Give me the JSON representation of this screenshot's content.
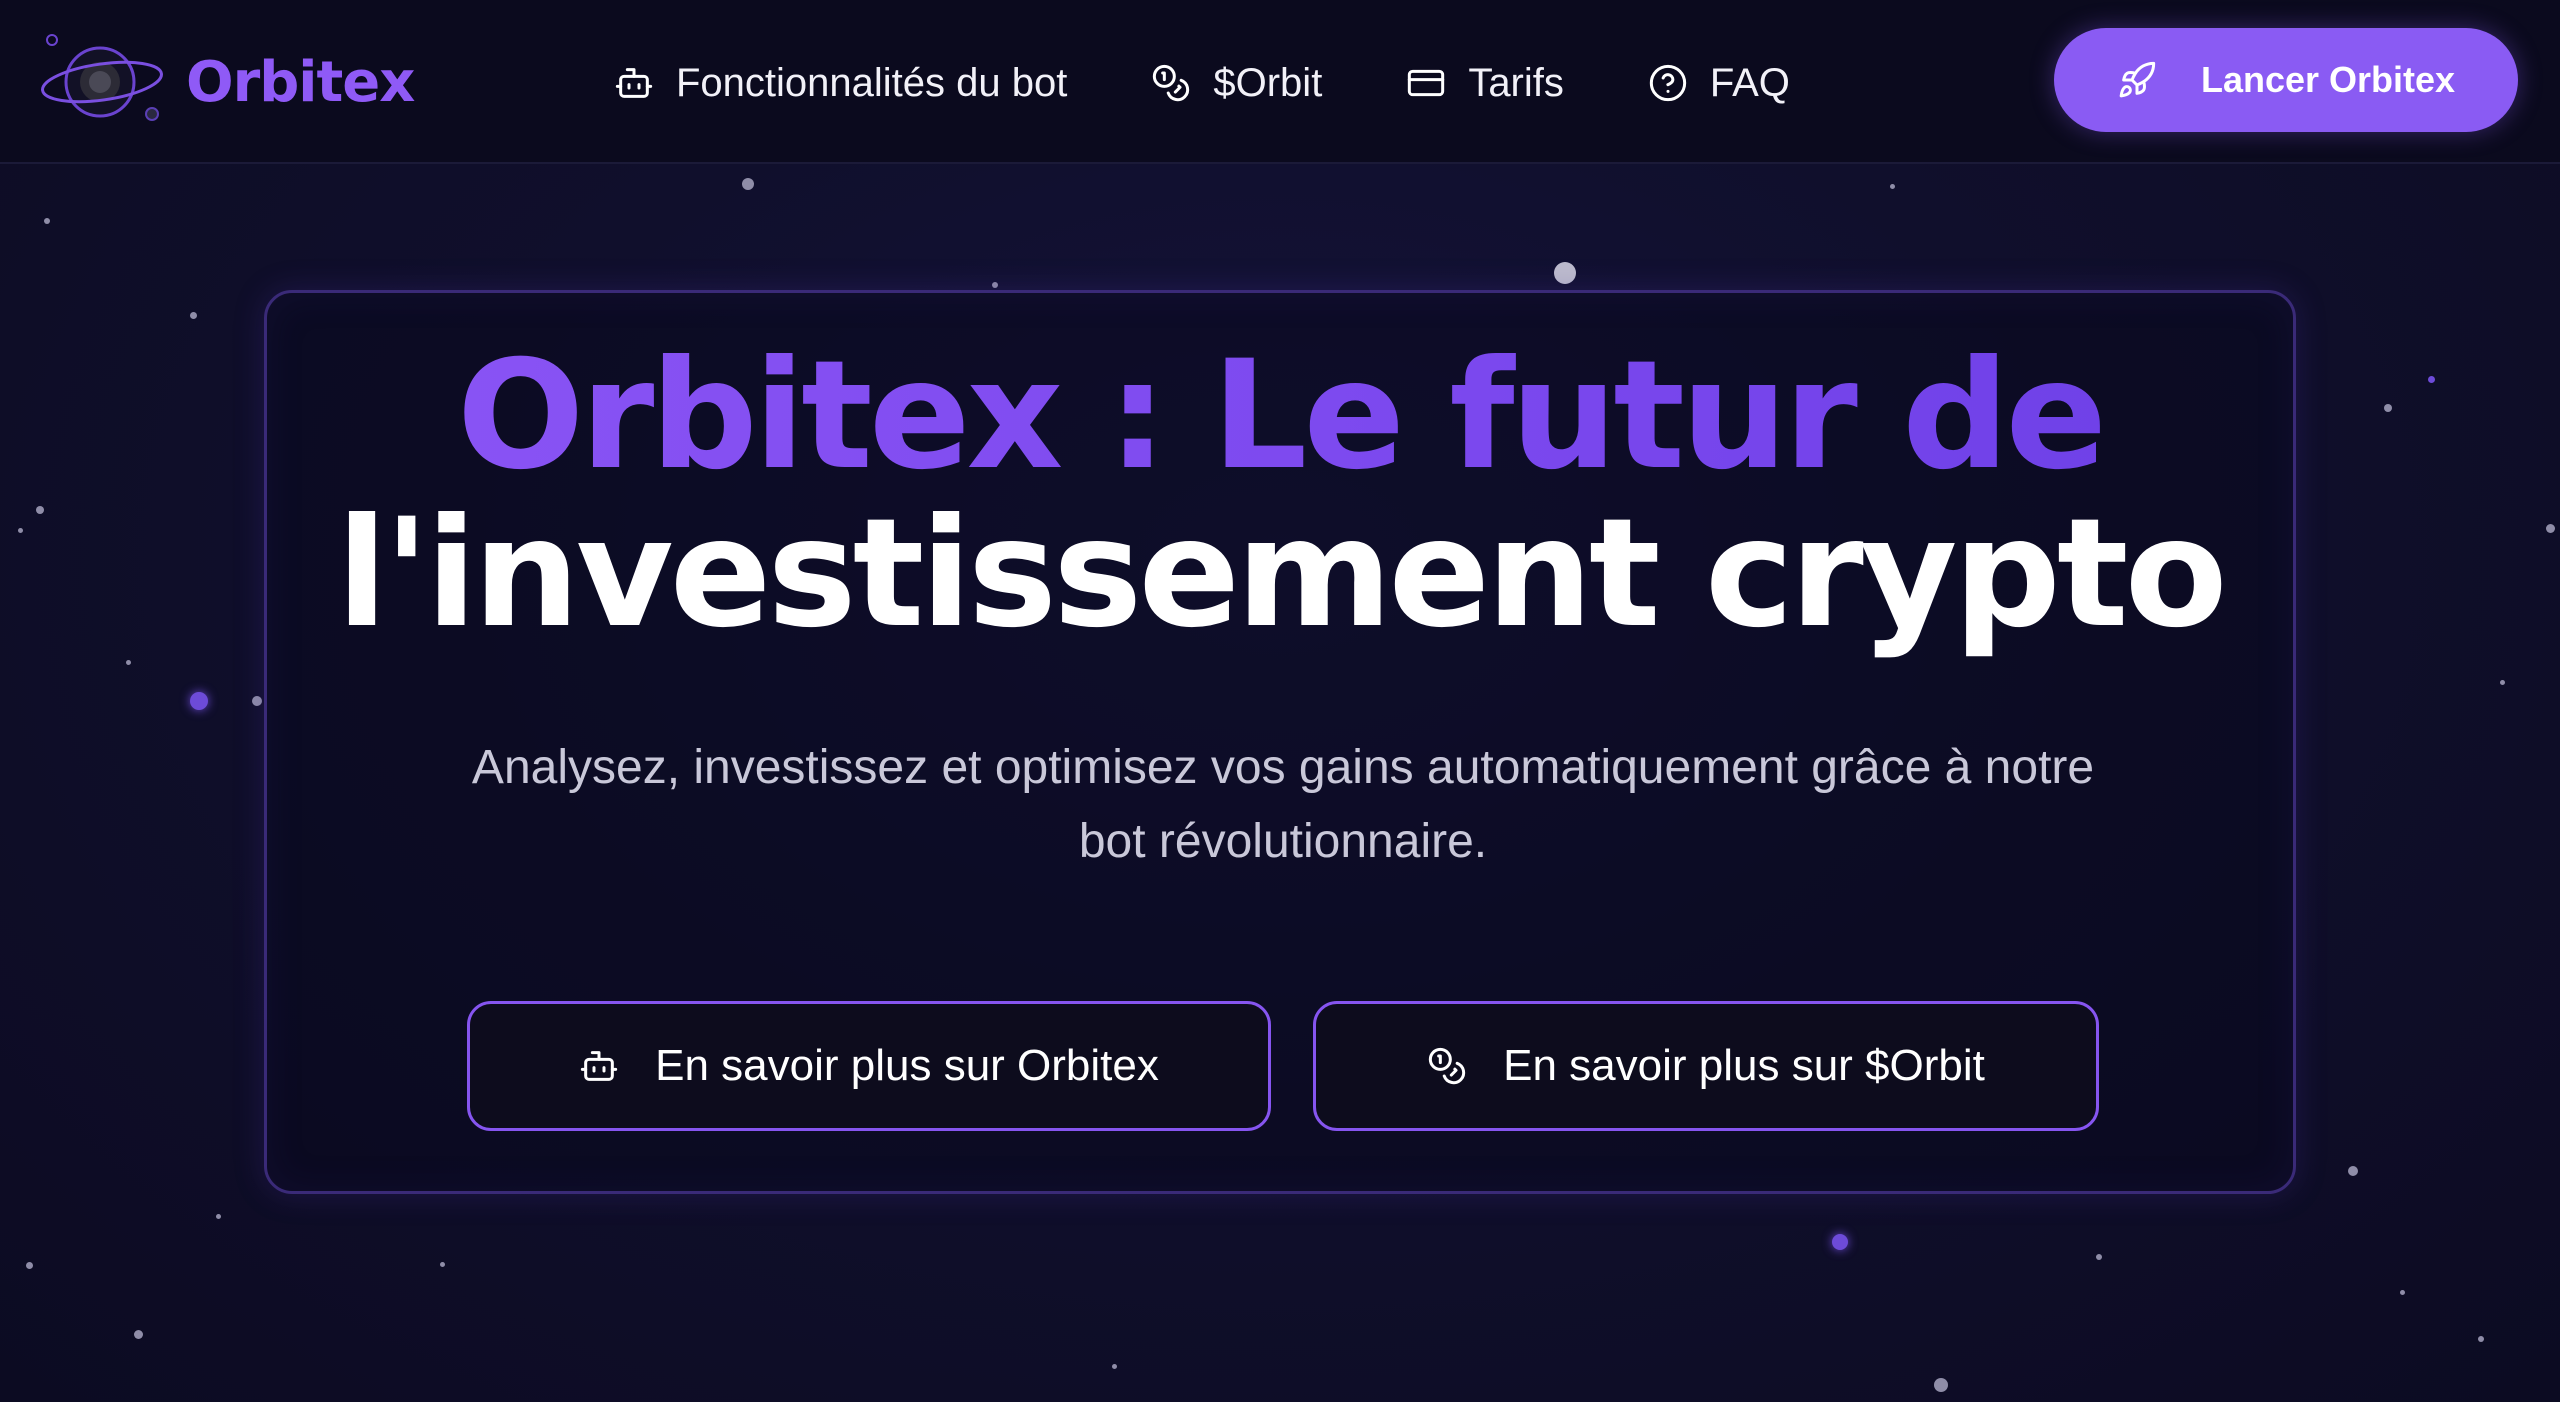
{
  "header": {
    "brand": "Orbitex",
    "nav": [
      {
        "label": "Fonctionnalités du bot",
        "icon": "bot-icon"
      },
      {
        "label": "$Orbit",
        "icon": "coins-icon"
      },
      {
        "label": "Tarifs",
        "icon": "credit-card-icon"
      },
      {
        "label": "FAQ",
        "icon": "help-circle-icon"
      }
    ],
    "cta": {
      "label": "Lancer Orbitex",
      "icon": "rocket-icon"
    }
  },
  "hero": {
    "title_line1": "Orbitex : Le futur de",
    "title_line2": "l'investissement crypto",
    "subtitle": "Analysez, investissez et optimisez vos gains automatiquement grâce à notre bot révolutionnaire.",
    "buttons": [
      {
        "label": "En savoir plus sur Orbitex",
        "icon": "bot-icon"
      },
      {
        "label": "En savoir plus sur $Orbit",
        "icon": "coins-icon"
      }
    ]
  },
  "colors": {
    "accent": "#8a5bf3",
    "background": "#0e0d24",
    "header_bg": "#0b0a1e",
    "title_accent": "#7e4cf0",
    "text": "#ffffff",
    "subtitle_text": "#c9c8d9"
  }
}
